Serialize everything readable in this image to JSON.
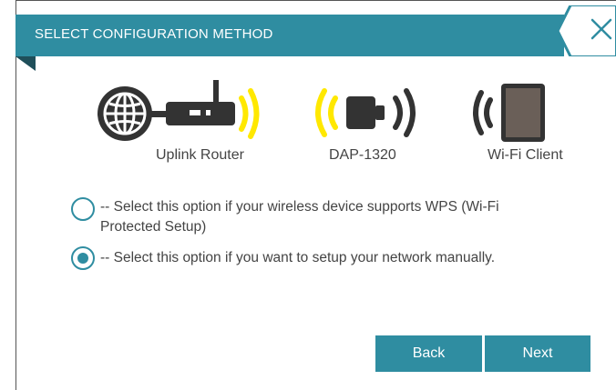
{
  "header": {
    "title": "SELECT CONFIGURATION METHOD",
    "close_icon": "close-icon"
  },
  "devices": [
    {
      "label": "Uplink Router",
      "icon": "router-icon"
    },
    {
      "label": "DAP-1320",
      "icon": "range-extender-icon"
    },
    {
      "label": "Wi-Fi Client",
      "icon": "tablet-icon"
    }
  ],
  "options": [
    {
      "text_line1": "-- Select this option if your wireless device supports WPS (Wi-Fi",
      "text_line2": "Protected Setup)",
      "selected": false
    },
    {
      "text_line1": "-- Select this option if you want to setup your network manually.",
      "selected": true
    }
  ],
  "buttons": {
    "back": "Back",
    "next": "Next"
  },
  "colors": {
    "accent": "#2f8da1",
    "signal": "#ffe800",
    "dark": "#333333"
  }
}
